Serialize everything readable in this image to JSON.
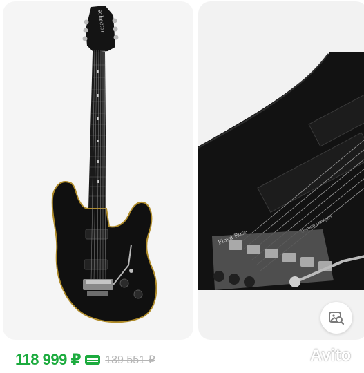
{
  "listing": {
    "price": "118 999 ₽",
    "old_price": "139 551 ₽",
    "watermark": "Avito",
    "price_color": "#1cab3e",
    "photos": [
      {
        "subject": "black electric guitar full view"
      },
      {
        "subject": "guitar body close-up with tremolo bridge"
      }
    ],
    "headstock_brand": "schecter",
    "bridge_engraving": "Floyd Rose",
    "pickup_engraving": "Demon Designs"
  },
  "icons": {
    "image_search": "image-search-icon",
    "discount": "discount-tag-icon",
    "avito_logo": "avito-logo-icon"
  }
}
